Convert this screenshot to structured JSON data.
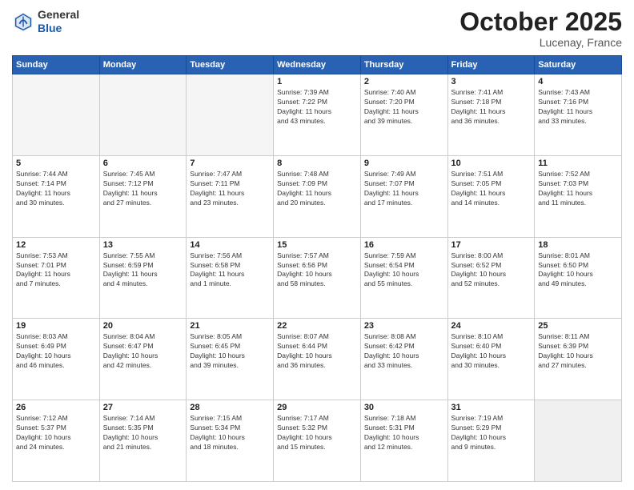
{
  "header": {
    "logo_general": "General",
    "logo_blue": "Blue",
    "month": "October 2025",
    "location": "Lucenay, France"
  },
  "weekdays": [
    "Sunday",
    "Monday",
    "Tuesday",
    "Wednesday",
    "Thursday",
    "Friday",
    "Saturday"
  ],
  "weeks": [
    [
      {
        "day": "",
        "info": ""
      },
      {
        "day": "",
        "info": ""
      },
      {
        "day": "",
        "info": ""
      },
      {
        "day": "1",
        "info": "Sunrise: 7:39 AM\nSunset: 7:22 PM\nDaylight: 11 hours\nand 43 minutes."
      },
      {
        "day": "2",
        "info": "Sunrise: 7:40 AM\nSunset: 7:20 PM\nDaylight: 11 hours\nand 39 minutes."
      },
      {
        "day": "3",
        "info": "Sunrise: 7:41 AM\nSunset: 7:18 PM\nDaylight: 11 hours\nand 36 minutes."
      },
      {
        "day": "4",
        "info": "Sunrise: 7:43 AM\nSunset: 7:16 PM\nDaylight: 11 hours\nand 33 minutes."
      }
    ],
    [
      {
        "day": "5",
        "info": "Sunrise: 7:44 AM\nSunset: 7:14 PM\nDaylight: 11 hours\nand 30 minutes."
      },
      {
        "day": "6",
        "info": "Sunrise: 7:45 AM\nSunset: 7:12 PM\nDaylight: 11 hours\nand 27 minutes."
      },
      {
        "day": "7",
        "info": "Sunrise: 7:47 AM\nSunset: 7:11 PM\nDaylight: 11 hours\nand 23 minutes."
      },
      {
        "day": "8",
        "info": "Sunrise: 7:48 AM\nSunset: 7:09 PM\nDaylight: 11 hours\nand 20 minutes."
      },
      {
        "day": "9",
        "info": "Sunrise: 7:49 AM\nSunset: 7:07 PM\nDaylight: 11 hours\nand 17 minutes."
      },
      {
        "day": "10",
        "info": "Sunrise: 7:51 AM\nSunset: 7:05 PM\nDaylight: 11 hours\nand 14 minutes."
      },
      {
        "day": "11",
        "info": "Sunrise: 7:52 AM\nSunset: 7:03 PM\nDaylight: 11 hours\nand 11 minutes."
      }
    ],
    [
      {
        "day": "12",
        "info": "Sunrise: 7:53 AM\nSunset: 7:01 PM\nDaylight: 11 hours\nand 7 minutes."
      },
      {
        "day": "13",
        "info": "Sunrise: 7:55 AM\nSunset: 6:59 PM\nDaylight: 11 hours\nand 4 minutes."
      },
      {
        "day": "14",
        "info": "Sunrise: 7:56 AM\nSunset: 6:58 PM\nDaylight: 11 hours\nand 1 minute."
      },
      {
        "day": "15",
        "info": "Sunrise: 7:57 AM\nSunset: 6:56 PM\nDaylight: 10 hours\nand 58 minutes."
      },
      {
        "day": "16",
        "info": "Sunrise: 7:59 AM\nSunset: 6:54 PM\nDaylight: 10 hours\nand 55 minutes."
      },
      {
        "day": "17",
        "info": "Sunrise: 8:00 AM\nSunset: 6:52 PM\nDaylight: 10 hours\nand 52 minutes."
      },
      {
        "day": "18",
        "info": "Sunrise: 8:01 AM\nSunset: 6:50 PM\nDaylight: 10 hours\nand 49 minutes."
      }
    ],
    [
      {
        "day": "19",
        "info": "Sunrise: 8:03 AM\nSunset: 6:49 PM\nDaylight: 10 hours\nand 46 minutes."
      },
      {
        "day": "20",
        "info": "Sunrise: 8:04 AM\nSunset: 6:47 PM\nDaylight: 10 hours\nand 42 minutes."
      },
      {
        "day": "21",
        "info": "Sunrise: 8:05 AM\nSunset: 6:45 PM\nDaylight: 10 hours\nand 39 minutes."
      },
      {
        "day": "22",
        "info": "Sunrise: 8:07 AM\nSunset: 6:44 PM\nDaylight: 10 hours\nand 36 minutes."
      },
      {
        "day": "23",
        "info": "Sunrise: 8:08 AM\nSunset: 6:42 PM\nDaylight: 10 hours\nand 33 minutes."
      },
      {
        "day": "24",
        "info": "Sunrise: 8:10 AM\nSunset: 6:40 PM\nDaylight: 10 hours\nand 30 minutes."
      },
      {
        "day": "25",
        "info": "Sunrise: 8:11 AM\nSunset: 6:39 PM\nDaylight: 10 hours\nand 27 minutes."
      }
    ],
    [
      {
        "day": "26",
        "info": "Sunrise: 7:12 AM\nSunset: 5:37 PM\nDaylight: 10 hours\nand 24 minutes."
      },
      {
        "day": "27",
        "info": "Sunrise: 7:14 AM\nSunset: 5:35 PM\nDaylight: 10 hours\nand 21 minutes."
      },
      {
        "day": "28",
        "info": "Sunrise: 7:15 AM\nSunset: 5:34 PM\nDaylight: 10 hours\nand 18 minutes."
      },
      {
        "day": "29",
        "info": "Sunrise: 7:17 AM\nSunset: 5:32 PM\nDaylight: 10 hours\nand 15 minutes."
      },
      {
        "day": "30",
        "info": "Sunrise: 7:18 AM\nSunset: 5:31 PM\nDaylight: 10 hours\nand 12 minutes."
      },
      {
        "day": "31",
        "info": "Sunrise: 7:19 AM\nSunset: 5:29 PM\nDaylight: 10 hours\nand 9 minutes."
      },
      {
        "day": "",
        "info": ""
      }
    ]
  ]
}
